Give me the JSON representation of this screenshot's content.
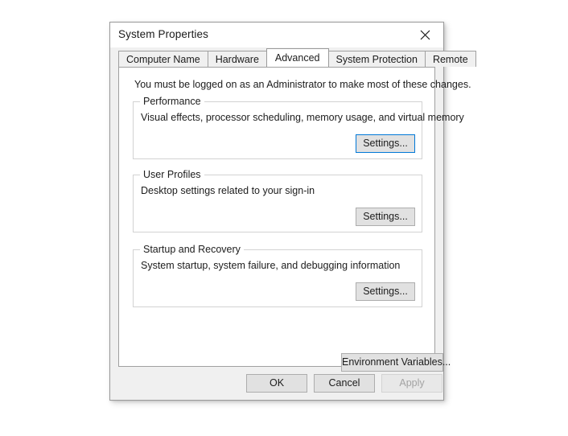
{
  "window": {
    "title": "System Properties",
    "close_label": "Close",
    "close_icon": "close-icon"
  },
  "tabs": [
    {
      "label": "Computer Name",
      "selected": false
    },
    {
      "label": "Hardware",
      "selected": false
    },
    {
      "label": "Advanced",
      "selected": true
    },
    {
      "label": "System Protection",
      "selected": false
    },
    {
      "label": "Remote",
      "selected": false
    }
  ],
  "panel": {
    "admin_note": "You must be logged on as an Administrator to make most of these changes.",
    "groups": [
      {
        "legend": "Performance",
        "description": "Visual effects, processor scheduling, memory usage, and virtual memory",
        "button_label": "Settings...",
        "button_focused": true
      },
      {
        "legend": "User Profiles",
        "description": "Desktop settings related to your sign-in",
        "button_label": "Settings...",
        "button_focused": false
      },
      {
        "legend": "Startup and Recovery",
        "description": "System startup, system failure, and debugging information",
        "button_label": "Settings...",
        "button_focused": false
      }
    ],
    "environment_variables_label": "Environment Variables..."
  },
  "footer": {
    "ok_label": "OK",
    "cancel_label": "Cancel",
    "apply_label": "Apply",
    "apply_disabled": true
  },
  "colors": {
    "focus_accent": "#0078d7",
    "dialog_background": "#f0f0f0",
    "panel_background": "#ffffff",
    "button_face": "#e1e1e1",
    "text": "#1c1c1c",
    "disabled_text": "#a3a3a3"
  }
}
